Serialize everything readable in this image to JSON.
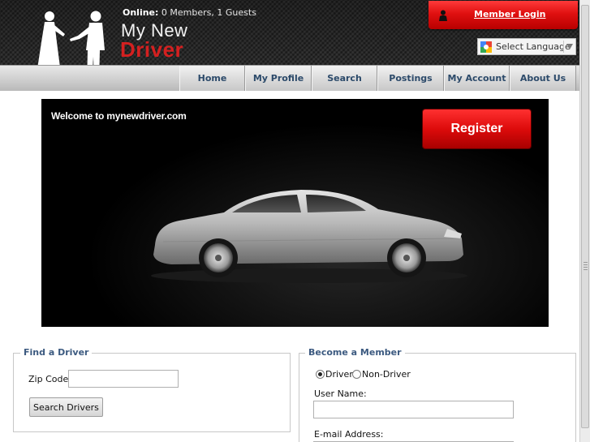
{
  "header": {
    "online_label": "Online:",
    "online_status": "0 Members, 1 Guests",
    "logo_line1": "My New",
    "logo_line2": "Driver",
    "login_label": "Member Login",
    "language_label": "Select Language",
    "icons": [
      "couple-silhouette-icon",
      "person-icon",
      "google-icon",
      "dropdown-arrow-icon"
    ]
  },
  "nav": {
    "items": [
      {
        "label": "Home"
      },
      {
        "label": "My Profile"
      },
      {
        "label": "Search"
      },
      {
        "label": "Postings"
      },
      {
        "label": "My Account"
      },
      {
        "label": "About Us"
      }
    ]
  },
  "banner": {
    "welcome": "Welcome to mynewdriver.com",
    "register_label": "Register"
  },
  "find_driver": {
    "legend": "Find a Driver",
    "zip_label": "Zip Code:",
    "zip_value": "",
    "search_button": "Search Drivers"
  },
  "become_member": {
    "legend": "Become a Member",
    "options": [
      {
        "label": "Driver",
        "selected": true
      },
      {
        "label": "Non-Driver",
        "selected": false
      }
    ],
    "username_label": "User Name:",
    "username_value": "",
    "email_label": "E-mail Address:"
  },
  "colors": {
    "accent_red": "#d42020",
    "nav_text": "#2c4a6a",
    "legend_text": "#3c5a80"
  }
}
